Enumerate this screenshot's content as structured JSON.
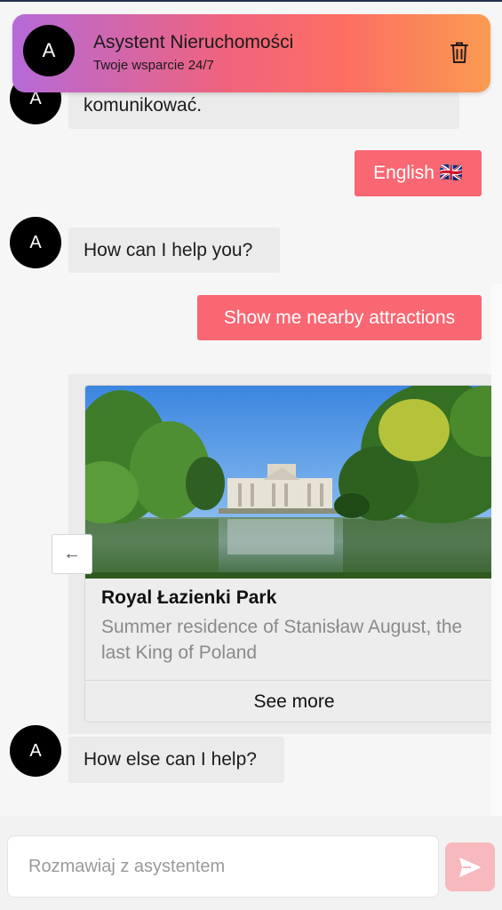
{
  "header": {
    "avatar_letter": "A",
    "title": "Asystent Nieruchomości",
    "subtitle": "Twoje wsparcie 24/7",
    "gradient_colors": [
      "#b56ad9",
      "#f0637d",
      "#f99b51"
    ]
  },
  "messages": [
    {
      "role": "bot",
      "avatar": "A",
      "text": "komunikować."
    },
    {
      "role": "user",
      "text": "English 🇬🇧"
    },
    {
      "role": "bot",
      "avatar": "A",
      "text": "How can I help you?"
    },
    {
      "role": "user",
      "text": "Show me nearby attractions"
    },
    {
      "role": "bot",
      "avatar": "A",
      "text": "How else can I help?"
    }
  ],
  "card": {
    "title": "Royal Łazienki Park",
    "description": "Summer residence of Stanisław August, the last King of Poland",
    "button_label": "See more",
    "prev_arrow": "←"
  },
  "input": {
    "placeholder": "Rozmawiaj z asystentem"
  },
  "colors": {
    "user_bubble": "#f86772",
    "bot_bubble": "#ebebeb",
    "send_button": "#f7b9bd"
  }
}
